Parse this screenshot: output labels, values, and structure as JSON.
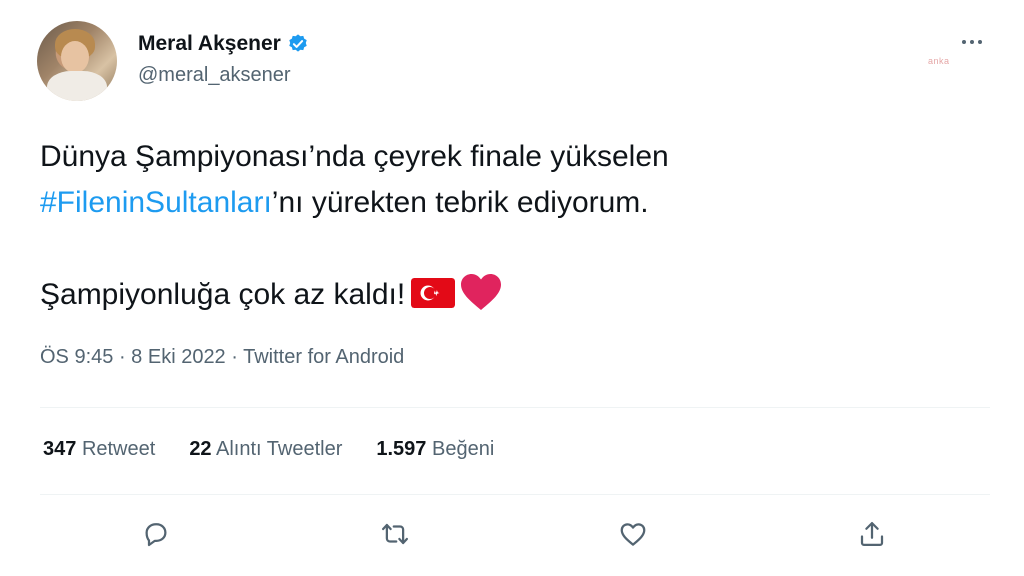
{
  "author": {
    "name": "Meral Akşener",
    "handle": "@meral_aksener",
    "verified": true,
    "avatar_icon": "avatar-photo"
  },
  "watermark": "anka",
  "tweet": {
    "line1": "Dünya Şampiyonası’nda çeyrek finale yükselen",
    "hashtag": "#FileninSultanları",
    "line2_rest": "’nı yürekten tebrik ediyorum.",
    "line3": "Şampiyonluğa çok az kaldı!",
    "emojis": [
      "turkey-flag",
      "red-heart"
    ]
  },
  "meta": {
    "time": "ÖS 9:45",
    "sep1": " · ",
    "date": "8 Eki 2022",
    "sep2": " · ",
    "source": "Twitter for Android"
  },
  "stats": [
    {
      "count": "347",
      "label": "Retweet"
    },
    {
      "count": "22",
      "label": "Alıntı Tweetler"
    },
    {
      "count": "1.597",
      "label": "Beğeni"
    }
  ],
  "actions": [
    "reply-icon",
    "retweet-icon",
    "like-icon",
    "share-icon"
  ],
  "colors": {
    "text": "#0f1419",
    "secondary": "#536471",
    "link": "#1d9bf0",
    "verified": "#1d9bf0",
    "divider": "#eff3f4",
    "flag_red": "#e30a17",
    "heart_red": "#e0245e"
  }
}
